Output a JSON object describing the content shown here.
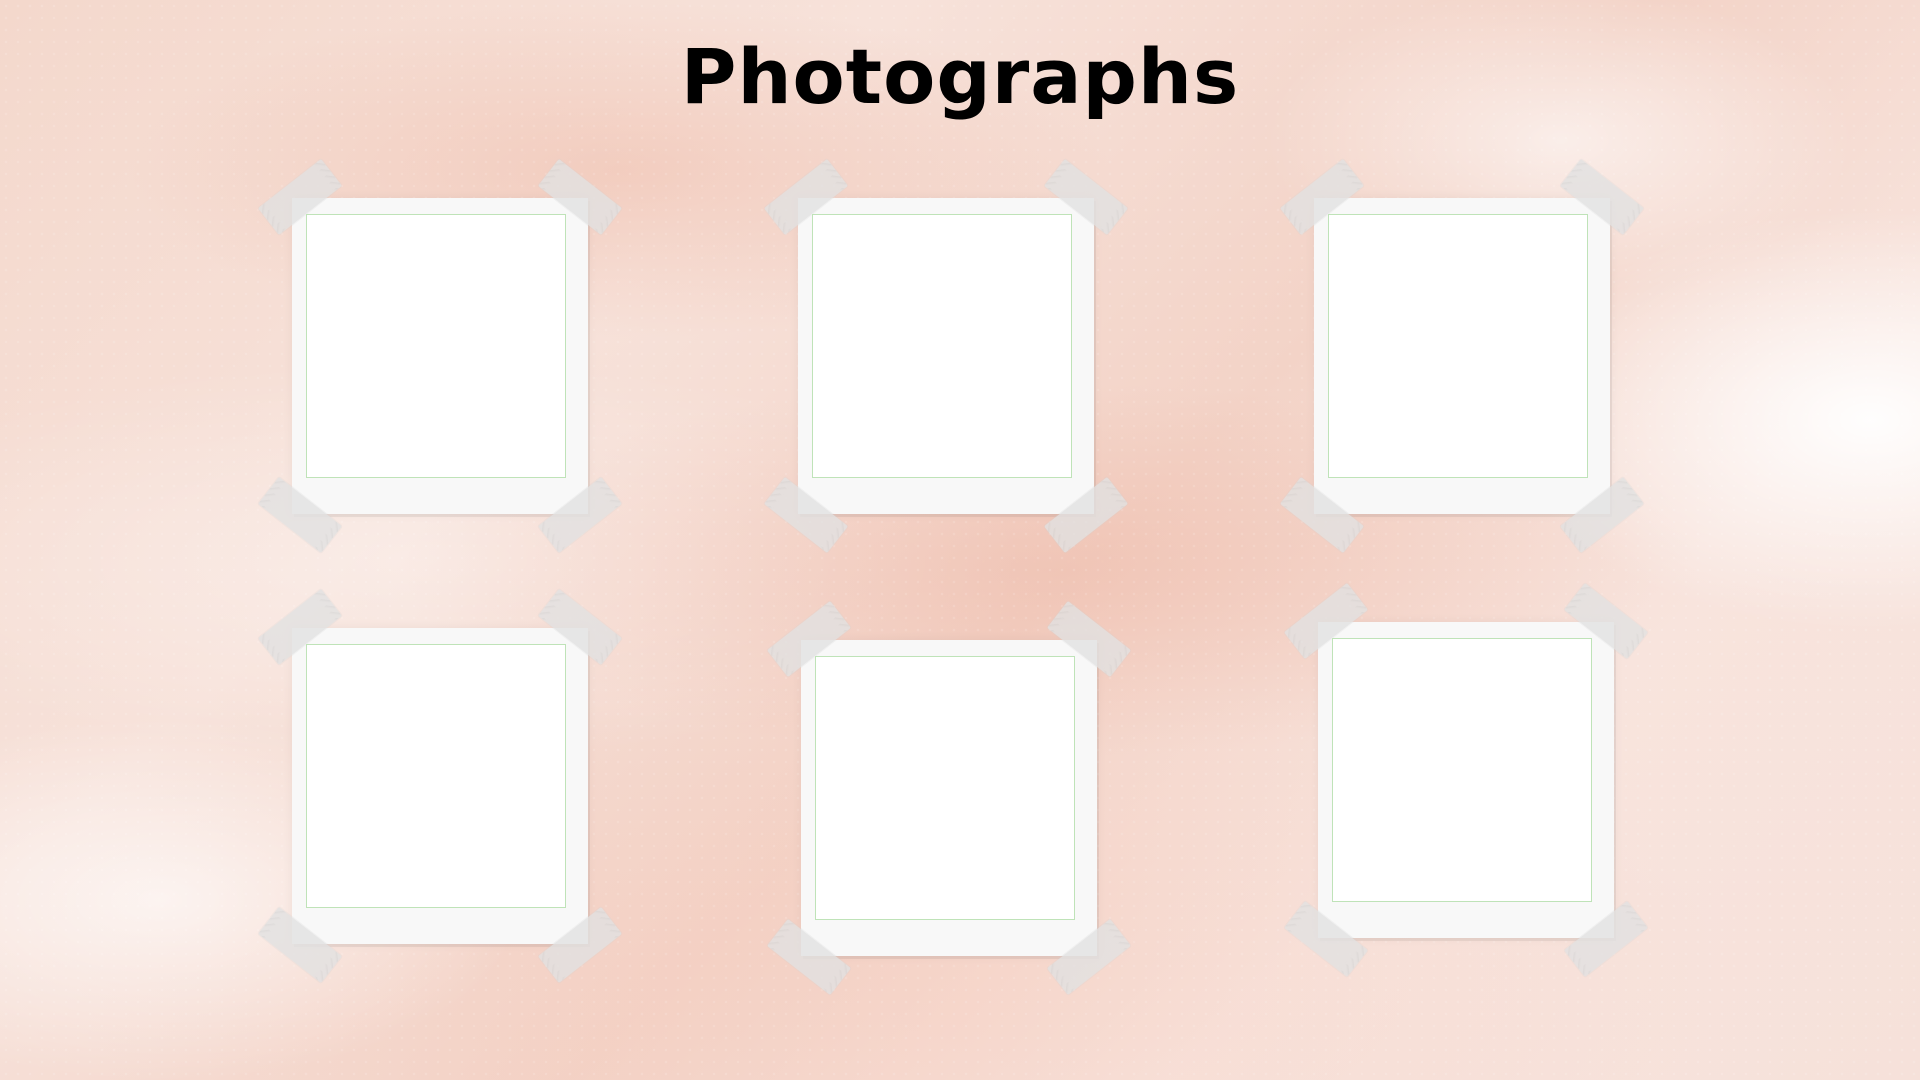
{
  "title": "Photographs",
  "frames": [
    {
      "id": 1,
      "label": ""
    },
    {
      "id": 2,
      "label": ""
    },
    {
      "id": 3,
      "label": ""
    },
    {
      "id": 4,
      "label": ""
    },
    {
      "id": 5,
      "label": ""
    },
    {
      "id": 6,
      "label": ""
    }
  ],
  "colors": {
    "background": "#f6e0d8",
    "frame": "#f8f8f8",
    "photo_area": "#ffffff",
    "photo_border": "#bfe3b8",
    "tape": "#e1e1e1",
    "title": "#000000"
  }
}
